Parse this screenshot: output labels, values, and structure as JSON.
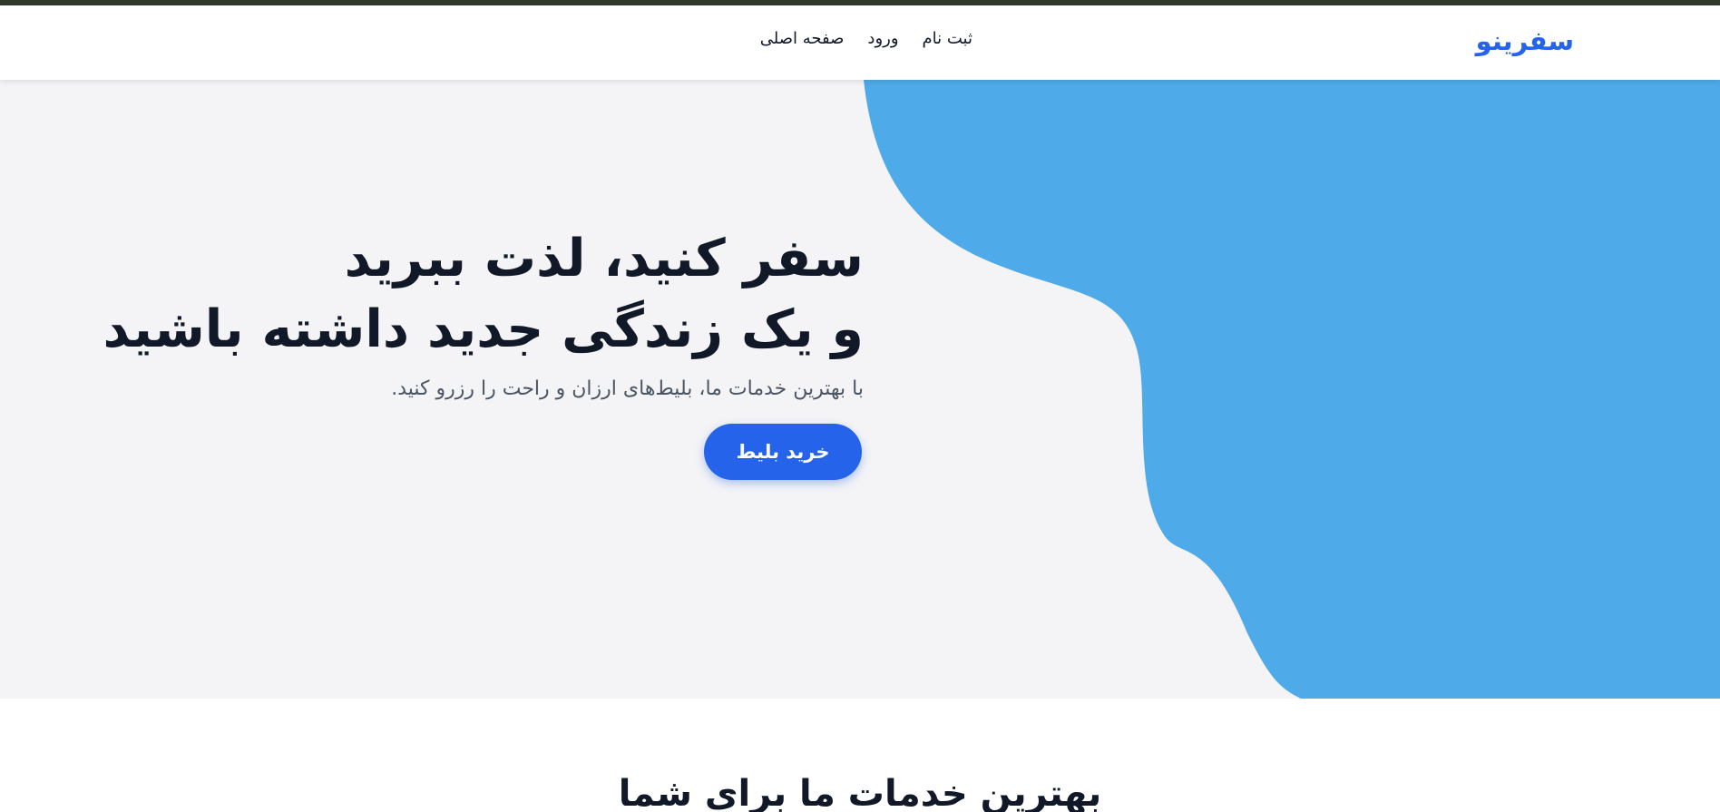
{
  "brand": {
    "name": "سفرینو"
  },
  "nav": {
    "items": [
      {
        "label": "صفحه اصلی"
      },
      {
        "label": "ورود"
      },
      {
        "label": "ثبت نام"
      }
    ]
  },
  "hero": {
    "title_line1": "سفر کنید، لذت ببرید",
    "title_line2": "و یک زندگی جدید داشته باشید",
    "subtitle": "با بهترین خدمات ما، بلیط‌های ارزان و راحت را رزرو کنید.",
    "cta_label": "خرید بلیط"
  },
  "services": {
    "title": "بهترین خدمات ما برای شما"
  },
  "colors": {
    "accent": "#2563eb",
    "wave": "#4eaae8",
    "hero_bg": "#f4f4f6",
    "top_strip": "#2f3a2b"
  }
}
